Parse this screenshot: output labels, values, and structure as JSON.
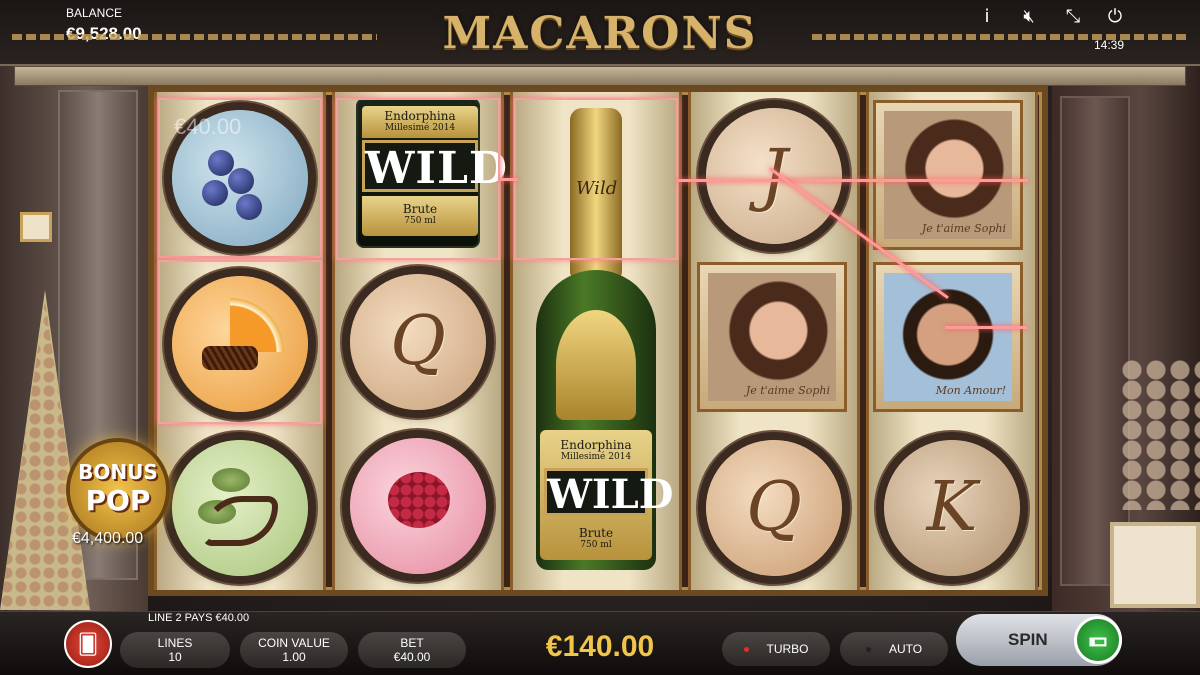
{
  "header": {
    "balance_label": "BALANCE",
    "balance_value": "€9,528.00",
    "title": "MACARONS",
    "time": "14:39",
    "icons": [
      "info-icon",
      "mute-icon",
      "fullscreen-icon",
      "power-icon"
    ]
  },
  "reels": {
    "reel1": {
      "cell1": {
        "symbol": "blueberry-macaron",
        "overlay_text": "€40.00"
      },
      "cell2": {
        "symbol": "orange-macaron"
      },
      "cell3": {
        "symbol": "pistachio-macaron"
      }
    },
    "reel2": {
      "wild": {
        "brand": "Endorphina",
        "vintage": "Millesimé 2014",
        "label": "WILD",
        "type": "Brute",
        "volume": "750 ml"
      },
      "cell2": {
        "symbol": "macaron-letter",
        "letter": "Q"
      },
      "cell3": {
        "symbol": "raspberry-macaron"
      }
    },
    "reel3": {
      "bottle": {
        "brand": "Endorphina",
        "vintage": "Millesimé 2014",
        "label": "WILD",
        "type": "Brute",
        "volume": "750 ml",
        "neck_text": "Wild"
      }
    },
    "reel4": {
      "cell1": {
        "symbol": "macaron-letter",
        "letter": "J"
      },
      "cell2": {
        "symbol": "woman-portrait",
        "signature": "Je t'aime Sophi"
      },
      "cell3": {
        "symbol": "macaron-letter",
        "letter": "Q"
      }
    },
    "reel5": {
      "cell1": {
        "symbol": "woman-portrait",
        "signature": "Je t'aime Sophi"
      },
      "cell2": {
        "symbol": "man-portrait",
        "signature": "Mon Amour!"
      },
      "cell3": {
        "symbol": "macaron-letter",
        "letter": "K"
      }
    }
  },
  "bonus": {
    "line1": "BONUS",
    "line2": "POP",
    "amount": "€4,400.00"
  },
  "footer": {
    "line_pays": "LINE 2 PAYS €40.00",
    "lines": {
      "label": "LINES",
      "value": "10"
    },
    "coin_value": {
      "label": "COIN VALUE",
      "value": "1.00"
    },
    "bet": {
      "label": "BET",
      "value": "€40.00"
    },
    "win_total": "€140.00",
    "turbo_label": "TURBO",
    "auto_label": "AUTO",
    "spin_label": "SPIN",
    "turbo_dot_color": "#e0302a",
    "auto_dot_color": "#222222"
  },
  "colors": {
    "highlight": "#f2a0a0",
    "gold": "#d7b26a",
    "win": "#f1c44a"
  }
}
